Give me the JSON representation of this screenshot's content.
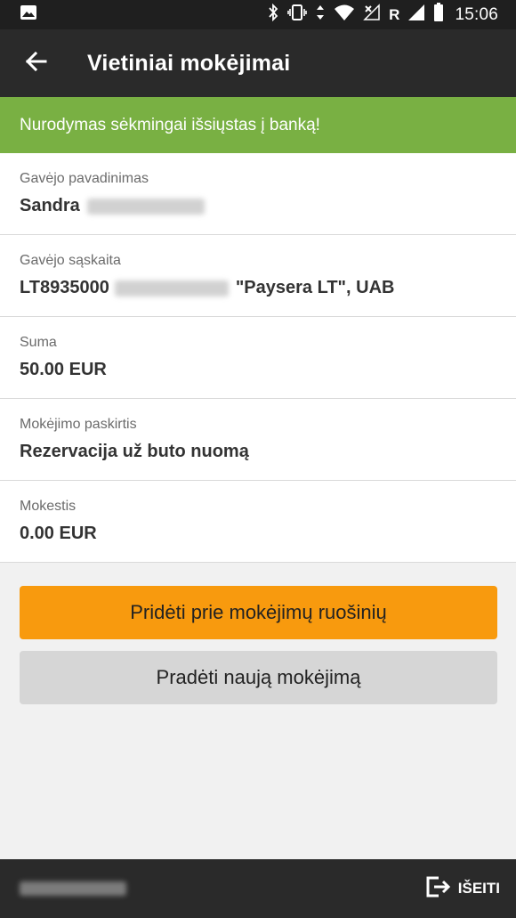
{
  "status_bar": {
    "time": "15:06",
    "network_letter": "R",
    "icons": [
      "image-notification-icon",
      "bluetooth-icon",
      "vibrate-icon",
      "data-arrows-icon",
      "wifi-icon",
      "no-signal-icon",
      "signal-icon",
      "battery-icon"
    ]
  },
  "app_bar": {
    "title": "Vietiniai mokėjimai",
    "back_icon": "arrow-back-icon"
  },
  "banner": {
    "message": "Nurodymas sėkmingai išsiųstas į banką!",
    "color": "#79b043"
  },
  "details": [
    {
      "label": "Gavėjo pavadinimas",
      "value": "Sandra",
      "value_suffix": ""
    },
    {
      "label": "Gavėjo sąskaita",
      "value": "LT8935000",
      "value_suffix": "\"Paysera LT\", UAB"
    },
    {
      "label": "Suma",
      "value": "50.00 EUR",
      "value_suffix": ""
    },
    {
      "label": "Mokėjimo paskirtis",
      "value": "Rezervacija už buto nuomą",
      "value_suffix": ""
    },
    {
      "label": "Mokestis",
      "value": "0.00 EUR",
      "value_suffix": ""
    }
  ],
  "buttons": {
    "primary_label": "Pridėti prie mokėjimų ruošinių",
    "primary_color": "#f89a0e",
    "secondary_label": "Pradėti naują mokėjimą"
  },
  "footer": {
    "logout_label": "IŠEITI",
    "logout_icon": "logout-icon"
  }
}
